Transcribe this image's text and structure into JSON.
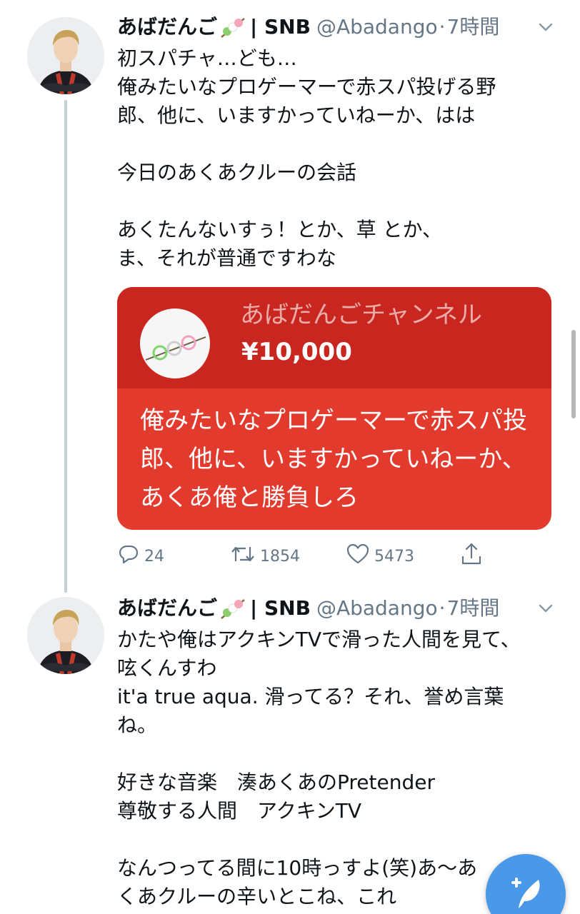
{
  "tweets": [
    {
      "display_name": "あばだんご",
      "name_suffix": "| SNB",
      "handle": "@Abadango",
      "separator": "·",
      "time": "7時間",
      "text_lines": [
        "初スパチャ…ども…",
        "俺みたいなプロゲーマーで赤スパ投げる野",
        "郎、他に、いますかっていねーか、はは",
        "",
        "今日のあくあクルーの会話",
        "",
        "あくたんないすぅ！とか、草 とか、",
        "ま、それが普通ですわな"
      ],
      "superchat": {
        "channel_name": "あばだんごチャンネル",
        "amount": "¥10,000",
        "message_lines": [
          "俺みたいなプロゲーマーで赤スパ投",
          "郎、他に、いますかっていねーか、",
          "あくあ俺と勝負しろ"
        ],
        "color_header": "#c9261f",
        "color_body": "#e23b2e"
      },
      "stats": {
        "replies": "24",
        "retweets": "1854",
        "likes": "5473"
      }
    },
    {
      "display_name": "あばだんご",
      "name_suffix": "| SNB",
      "handle": "@Abadango",
      "separator": "·",
      "time": "7時間",
      "text_lines": [
        "かたや俺はアクキンTVで滑った人間を見て、",
        "呟くんすわ",
        "it'a true aqua.  滑ってる？それ、誉め言葉",
        "ね。",
        "",
        "好きな音楽　湊あくあのPretender",
        "尊敬する人間　アクキンTV",
        "",
        "なんつってる間に10時っすよ(笑)あ〜あ",
        "くあクルーの辛いとこね、これ"
      ]
    }
  ],
  "icons": {
    "reply": "reply-icon",
    "retweet": "retweet-icon",
    "like": "heart-icon",
    "share": "share-icon",
    "more": "chevron-down-icon",
    "compose": "compose-tweet-icon"
  },
  "colors": {
    "accent": "#4a99e9",
    "secondary_text": "#657786",
    "thread_line": "#c4cfd6"
  }
}
